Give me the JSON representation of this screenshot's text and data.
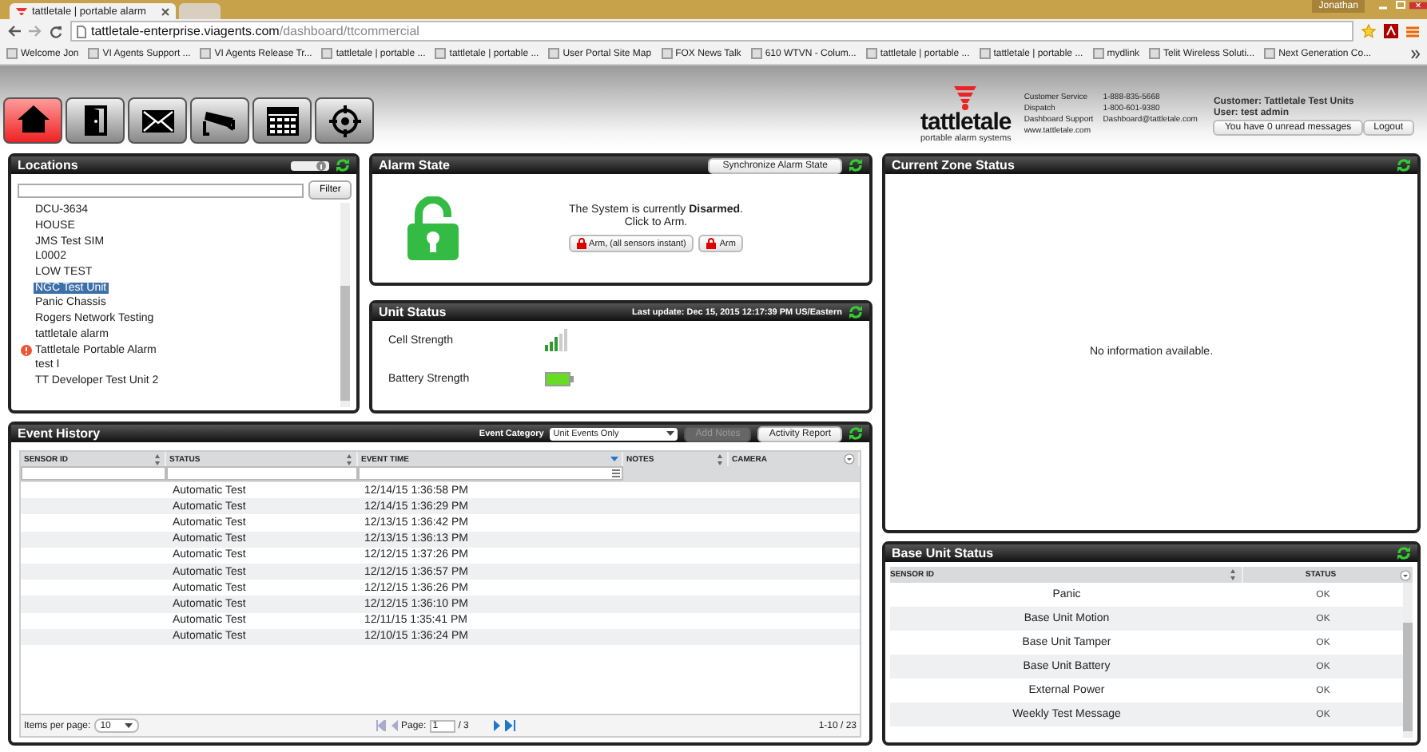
{
  "browser": {
    "tabs": [
      {
        "label": "tattletale | portable alarm",
        "selected": true
      },
      {
        "selected": false
      }
    ],
    "user": "Jonathan",
    "url": {
      "host": "tattletale-enterprise.viagents.com",
      "path": "/dashboard/ttcommercial"
    },
    "bookmarks": [
      "Welcome Jon",
      "VI Agents Support ...",
      "VI Agents Release Tr...",
      "tattletale | portable ...",
      "tattletale | portable ...",
      "User Portal Site Map",
      "FOX News Talk",
      "610 WTVN - Colum...",
      "tattletale | portable ...",
      "tattletale | portable ...",
      "mydlink",
      "Telit Wireless Soluti...",
      "Next Generation Co..."
    ]
  },
  "header": {
    "nav": [
      {
        "kind": "home",
        "selected": true
      },
      {
        "kind": "door",
        "selected": false
      },
      {
        "kind": "mail",
        "selected": false
      },
      {
        "kind": "camera",
        "selected": false
      },
      {
        "kind": "keypad",
        "selected": false
      },
      {
        "kind": "target",
        "selected": false
      }
    ],
    "logo": {
      "name": "tattletale",
      "tagline": "portable alarm systems"
    },
    "contacts": [
      {
        "label": "Customer Service",
        "value": "1-888-835-5668"
      },
      {
        "label": "Dispatch",
        "value": "1-800-601-9380"
      },
      {
        "label": "Dashboard Support",
        "value": "Dashboard@tattletale.com"
      },
      {
        "label": "www.tattletale.com"
      }
    ],
    "customer": "Customer: Tattletale Test Units",
    "user": "User: test admin",
    "messages": "You have 0 unread messages",
    "logout": "Logout"
  },
  "locations": {
    "title": "Locations",
    "filter": "Filter",
    "items": [
      {
        "name": "DCU-3634",
        "selected": false,
        "alert": false
      },
      {
        "name": "HOUSE",
        "selected": false,
        "alert": false
      },
      {
        "name": "JMS Test SIM",
        "selected": false,
        "alert": false
      },
      {
        "name": "L0002",
        "selected": false,
        "alert": false
      },
      {
        "name": "LOW TEST",
        "selected": false,
        "alert": false
      },
      {
        "name": "NGC Test Unit",
        "selected": true,
        "alert": false
      },
      {
        "name": "Panic Chassis",
        "selected": false,
        "alert": false
      },
      {
        "name": "Rogers Network Testing",
        "selected": false,
        "alert": false
      },
      {
        "name": "tattletale alarm",
        "selected": false,
        "alert": false
      },
      {
        "name": "Tattletale Portable Alarm",
        "selected": false,
        "alert": true
      },
      {
        "name": "test I",
        "selected": false,
        "alert": false
      },
      {
        "name": "TT Developer Test Unit 2",
        "selected": false,
        "alert": false
      }
    ]
  },
  "alarm": {
    "title": "Alarm State",
    "sync": "Synchronize Alarm State",
    "armed": false,
    "message": "The System is currently **Disarmed**.",
    "hint": "Click to Arm.",
    "buttons": [
      "Arm, (all sensors instant)",
      "Arm"
    ]
  },
  "unit_status": {
    "title": "Unit Status",
    "last_update": "Last update: Dec 15, 2015 12:17:39 PM US/Eastern",
    "rows": [
      {
        "kind": "signal",
        "label": "Cell Strength"
      },
      {
        "kind": "battery",
        "label": "Battery Strength"
      }
    ]
  },
  "event_history": {
    "title": "Event History",
    "category_label": "Event Category",
    "category": "Unit Events Only",
    "add_notes": {
      "label": "Add Notes",
      "disabled": true
    },
    "report": "Activity Report",
    "columns": [
      {
        "kind": "sortable",
        "label": "SENSOR ID",
        "filter": true,
        "sorted": false
      },
      {
        "kind": "sortable",
        "label": "STATUS",
        "filter": true,
        "sorted": false
      },
      {
        "kind": "sortable",
        "label": "EVENT TIME",
        "filter": true,
        "sorted": true
      },
      {
        "kind": "sortable",
        "label": "NOTES",
        "filter": false,
        "sorted": false
      },
      {
        "kind": "menu",
        "label": "CAMERA",
        "filter": false
      }
    ],
    "rows": [
      [
        "",
        "Automatic Test",
        "12/14/15 1:36:58 PM"
      ],
      [
        "",
        "Automatic Test",
        "12/14/15 1:36:29 PM"
      ],
      [
        "",
        "Automatic Test",
        "12/13/15 1:36:42 PM"
      ],
      [
        "",
        "Automatic Test",
        "12/13/15 1:36:13 PM"
      ],
      [
        "",
        "Automatic Test",
        "12/12/15 1:37:26 PM"
      ],
      [
        "",
        "Automatic Test",
        "12/12/15 1:36:57 PM"
      ],
      [
        "",
        "Automatic Test",
        "12/12/15 1:36:26 PM"
      ],
      [
        "",
        "Automatic Test",
        "12/12/15 1:36:10 PM"
      ],
      [
        "",
        "Automatic Test",
        "12/11/15 1:35:41 PM"
      ],
      [
        "",
        "Automatic Test",
        "12/10/15 1:36:24 PM"
      ]
    ],
    "pager": {
      "per_page_label": "Items per page:",
      "per_page": "10",
      "page_label": "Page:",
      "page": "1",
      "pages": "/ 3",
      "range": "1-10 / 23"
    }
  },
  "zone_status": {
    "title": "Current Zone Status",
    "empty": "No information available."
  },
  "base_unit": {
    "title": "Base Unit Status",
    "columns": [
      "SENSOR ID",
      "STATUS"
    ],
    "rows": [
      [
        "Panic",
        "OK"
      ],
      [
        "Base Unit Motion",
        "OK"
      ],
      [
        "Base Unit Tamper",
        "OK"
      ],
      [
        "Base Unit Battery",
        "OK"
      ],
      [
        "External Power",
        "OK"
      ],
      [
        "Weekly Test Message",
        "OK"
      ]
    ]
  }
}
